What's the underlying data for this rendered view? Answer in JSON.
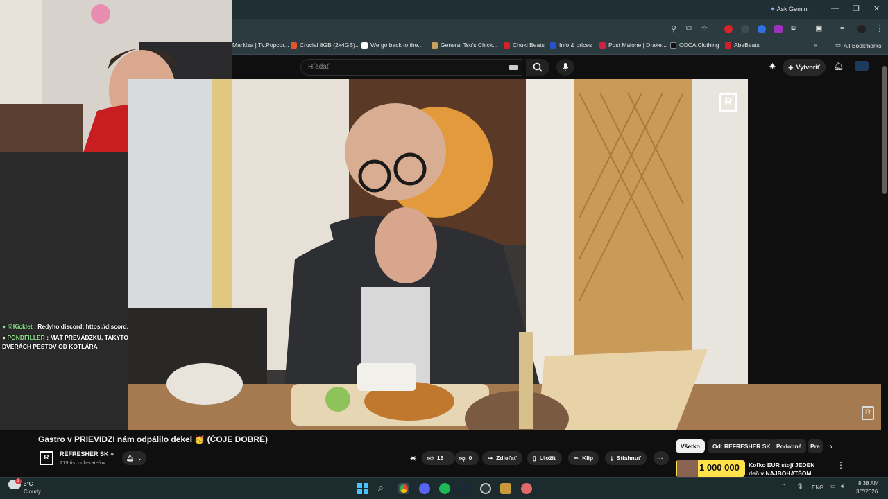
{
  "browser": {
    "gemini_label": "Ask Gemini",
    "bookmarks": [
      {
        "label": "Markíza | Tv.Popcor...",
        "color": "#555555"
      },
      {
        "label": "Crucial 8GB (2x4GB)...",
        "color": "#e0552b"
      },
      {
        "label": "We go back to the...",
        "color": "#ffffff"
      },
      {
        "label": "General Tso's Chick...",
        "color": "#c8a060"
      },
      {
        "label": "Chuki Beats",
        "color": "#d0202a"
      },
      {
        "label": "Info & prices",
        "color": "#2255cc"
      },
      {
        "label": "Post Malone | Drake...",
        "color": "#cc2244"
      },
      {
        "label": "COCA Clothing",
        "color": "#111111"
      },
      {
        "label": "AbeBeats",
        "color": "#d0202a"
      }
    ],
    "all_bookmarks": "All Bookmarks"
  },
  "youtube": {
    "search_placeholder": "Hľadať",
    "create_label": "Vytvoriť",
    "video_title": "Gastro v PRIEVIDZI nám odpálilo dekel 🥳 (ČOJE DOBRÉ)",
    "channel_name": "REFRESHER SK",
    "subscribers": "219 tis. odberateľov",
    "likes": "15",
    "dislikes": "0",
    "share": "Zdieľať",
    "save": "Uložiť",
    "clip": "Klip",
    "download": "Stiahnuť",
    "chips": [
      "Všetko",
      "Od: REFRESHER SK",
      "Podobné",
      "Pre"
    ],
    "rec_title": "Koľko EUR stojí JEDEN deň v NAJBOHATŠOM meste ...",
    "rec_thumb_text": "1 000 000"
  },
  "chat": [
    {
      "user": "@Kicklet",
      "text": ": Redyho discord: https://discord.gg/xAhYcNkPPJ"
    },
    {
      "user": "PONDFILLER",
      "text": ": MAŤ PREVÁDZKU, TAKÝTO KOKOTI BY DOSTALI NA DVERÁCH PESTOV OD KOTLÁRA"
    }
  ],
  "taskbar": {
    "temperature": "3°C",
    "weather": "Cloudy",
    "weather_badge": "2",
    "lang": "ENG",
    "time": "8:38 AM",
    "date": "3/7/2026"
  }
}
